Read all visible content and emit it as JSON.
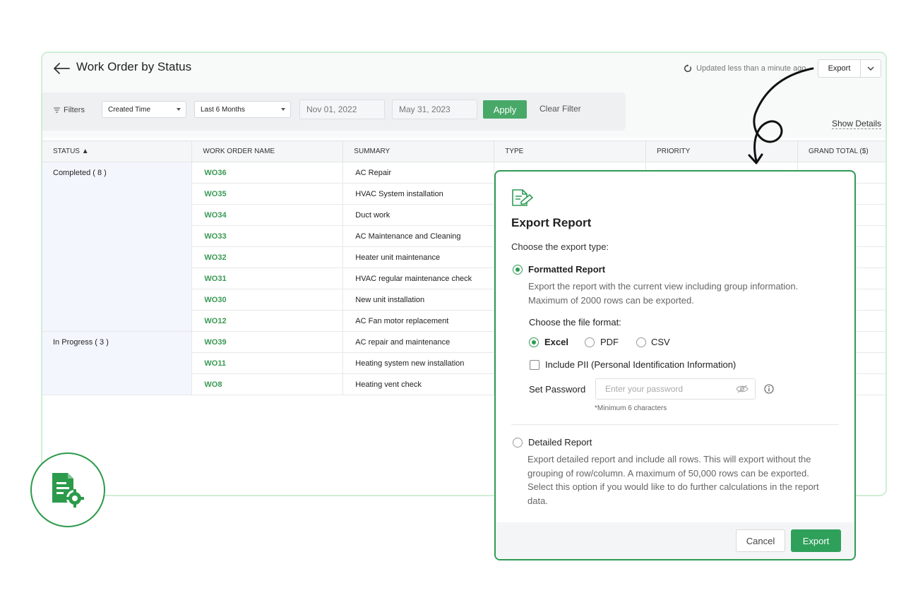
{
  "header": {
    "title": "Work Order by Status",
    "updated_text": "Updated less than a minute ago",
    "export_label": "Export"
  },
  "filters": {
    "label": "Filters",
    "field_select": "Created Time",
    "range_select": "Last 6 Months",
    "start_date": "Nov 01, 2022",
    "end_date": "May 31, 2023",
    "apply_label": "Apply",
    "clear_label": "Clear Filter"
  },
  "show_details_label": "Show Details",
  "table": {
    "columns": [
      "STATUS ▲",
      "WORK ORDER NAME",
      "SUMMARY",
      "TYPE",
      "PRIORITY",
      "GRAND TOTAL ($)"
    ],
    "groups": [
      {
        "status": "Completed ( 8 )",
        "rows": [
          {
            "wo": "WO36",
            "summary": "AC Repair"
          },
          {
            "wo": "WO35",
            "summary": "HVAC System installation"
          },
          {
            "wo": "WO34",
            "summary": "Duct work"
          },
          {
            "wo": "WO33",
            "summary": "AC Maintenance and Cleaning"
          },
          {
            "wo": "WO32",
            "summary": "Heater unit maintenance"
          },
          {
            "wo": "WO31",
            "summary": "HVAC regular maintenance check"
          },
          {
            "wo": "WO30",
            "summary": "New unit installation"
          },
          {
            "wo": "WO12",
            "summary": "AC Fan motor replacement"
          }
        ]
      },
      {
        "status": "In Progress ( 3 )",
        "rows": [
          {
            "wo": "WO39",
            "summary": "AC repair and maintenance"
          },
          {
            "wo": "WO11",
            "summary": "Heating system new installation"
          },
          {
            "wo": "WO8",
            "summary": "Heating vent check"
          }
        ]
      }
    ]
  },
  "dialog": {
    "title": "Export Report",
    "subtitle": "Choose the export type:",
    "formatted": {
      "label": "Formatted Report",
      "selected": true,
      "description": "Export the report with the current view including group information. Maximum of 2000 rows can be exported.",
      "format_prompt": "Choose the file format:",
      "formats": [
        {
          "label": "Excel",
          "selected": true
        },
        {
          "label": "PDF",
          "selected": false
        },
        {
          "label": "CSV",
          "selected": false
        }
      ],
      "pii_label": "Include PII (Personal Identification Information)",
      "password_label": "Set Password",
      "password_placeholder": "Enter your password",
      "password_hint": "*Minimum 6 characters"
    },
    "detailed": {
      "label": "Detailed Report",
      "selected": false,
      "description": "Export detailed report and include all rows. This will export without the grouping of row/column. A maximum of 50,000 rows can be exported. Select this option if you would like to do further calculations in the report data."
    },
    "cancel_label": "Cancel",
    "export_label": "Export"
  },
  "colors": {
    "accent": "#2f9b54",
    "link_green": "#3a9a54",
    "status_cell": "#f3f6fc"
  }
}
